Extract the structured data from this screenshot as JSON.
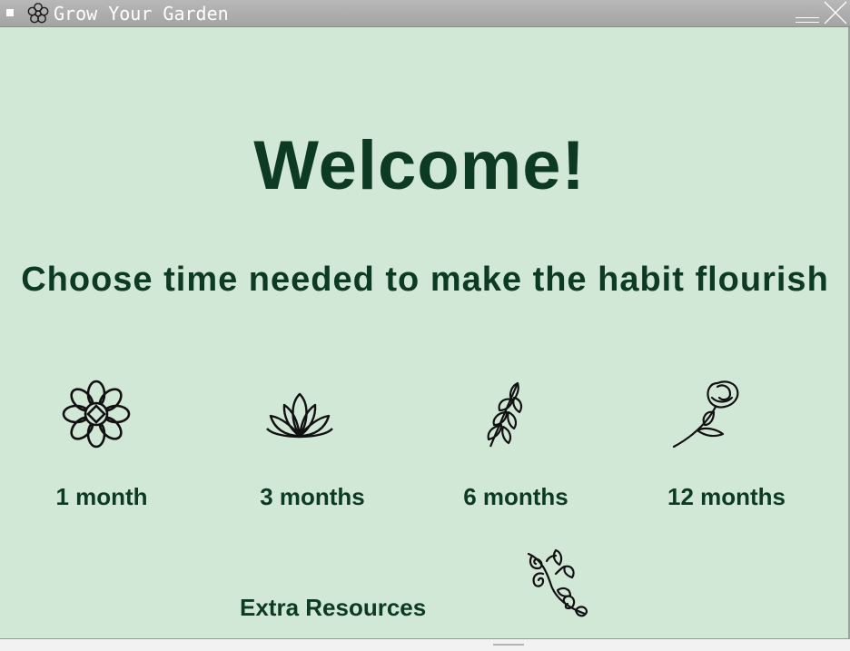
{
  "window": {
    "title": "Grow Your Garden",
    "app_icon": "flower-icon",
    "controls": [
      "minimize-icon",
      "close-icon"
    ]
  },
  "main": {
    "heading": "Welcome!",
    "prompt": "Choose time needed to make the habit flourish",
    "options": [
      {
        "label": "1 month",
        "icon": "flower-icon"
      },
      {
        "label": "3 months",
        "icon": "lotus-icon"
      },
      {
        "label": "6 months",
        "icon": "leaf-branch-icon"
      },
      {
        "label": "12 months",
        "icon": "rose-icon"
      }
    ],
    "extra": {
      "label": "Extra Resources",
      "icon": "vine-icon"
    }
  },
  "colors": {
    "background": "#d2e8d7",
    "text": "#0d3a23",
    "titlebar": "#aaaaaa"
  }
}
